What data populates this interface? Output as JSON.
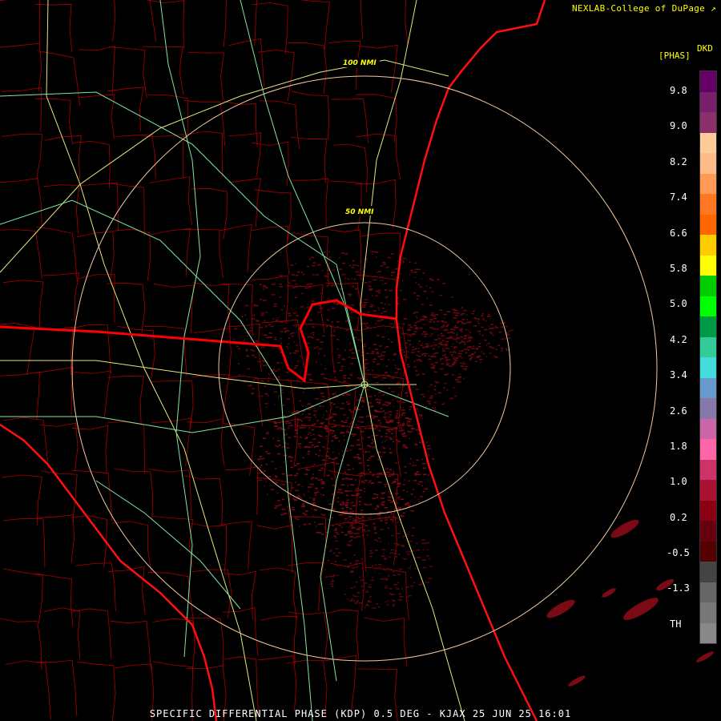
{
  "credit": "NEXLAB-College of DuPage",
  "legend": {
    "product_code": "DKD",
    "unit": "[PHAS]",
    "ticks": [
      "9.8",
      "9.0",
      "8.2",
      "7.4",
      "6.6",
      "5.8",
      "5.0",
      "4.2",
      "3.4",
      "2.6",
      "1.8",
      "1.0",
      "0.2",
      "-0.5",
      "-1.3",
      "TH"
    ],
    "colors": [
      "#660066",
      "#7a1f6a",
      "#8c2f6a",
      "#ffcc99",
      "#ffbb88",
      "#ff9955",
      "#ff7722",
      "#ff6600",
      "#ffcc00",
      "#ffff00",
      "#00cc00",
      "#00ff00",
      "#009944",
      "#33cc99",
      "#44dddd",
      "#6699cc",
      "#8877aa",
      "#cc66aa",
      "#ff66aa",
      "#cc3366",
      "#aa1133",
      "#880011",
      "#660011",
      "#550000",
      "#444444",
      "#666666",
      "#777777",
      "#888888"
    ]
  },
  "range_rings": [
    "100 NMI",
    "50 NMI"
  ],
  "caption": "SPECIFIC DIFFERENTIAL PHASE (KDP) 0.5 DEG - KJAX 25 JUN 25 16:01",
  "colors": {
    "background": "#000000",
    "county_lines": "#aa0000",
    "state_lines": "#ff0000",
    "coast": "#ff1010",
    "highways_major": "#e6e680",
    "highways_minor": "#80e6a0",
    "rings": "#f0c8a0",
    "returns": "#7a0a14"
  }
}
